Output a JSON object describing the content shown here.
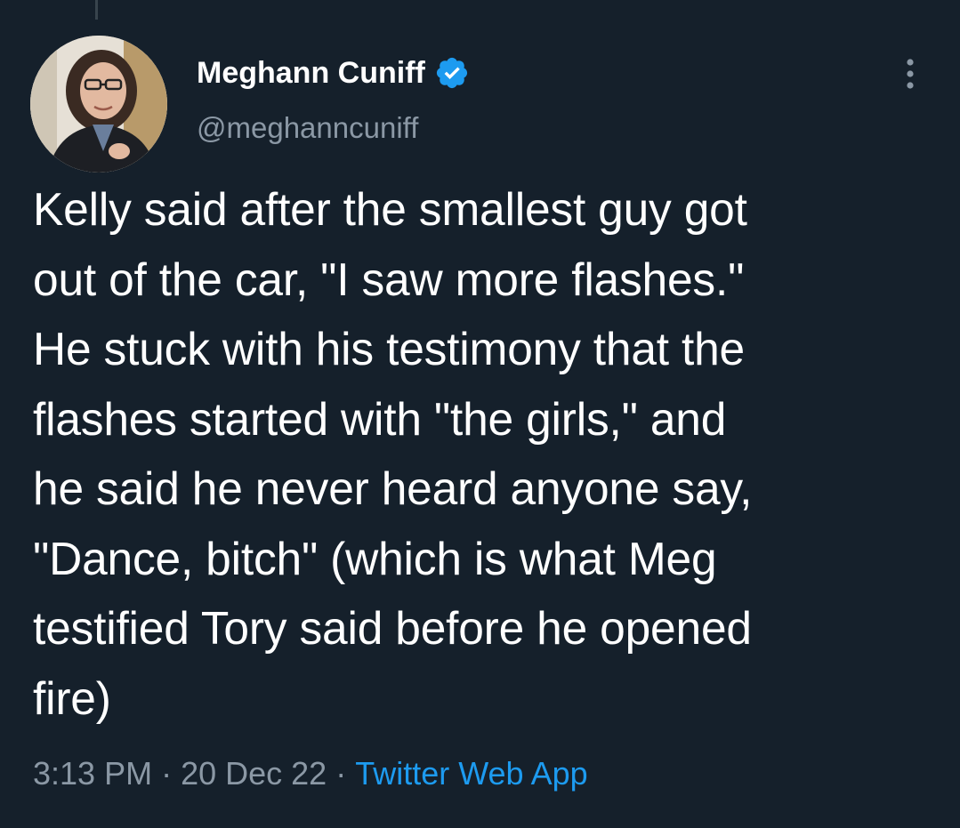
{
  "author": {
    "display_name": "Meghann Cuniff",
    "handle": "@meghanncuniff",
    "verified": true
  },
  "tweet": {
    "text": "Kelly said after the smallest guy got\nout of the car, \"I saw more flashes.\"\nHe stuck with his testimony that the\nflashes started with \"the girls,\" and\nhe said he never heard anyone say,\n\"Dance, bitch\" (which is what Meg\ntestified Tory said before he opened\nfire)",
    "time": "3:13 PM",
    "date": "20 Dec 22",
    "separator": "·",
    "source": "Twitter Web App"
  },
  "icons": {
    "verified": "verified-badge-icon",
    "more": "more-options-icon"
  },
  "colors": {
    "background": "#15202b",
    "text": "#ffffff",
    "secondary": "#8b98a5",
    "accent": "#1d9bf0"
  }
}
